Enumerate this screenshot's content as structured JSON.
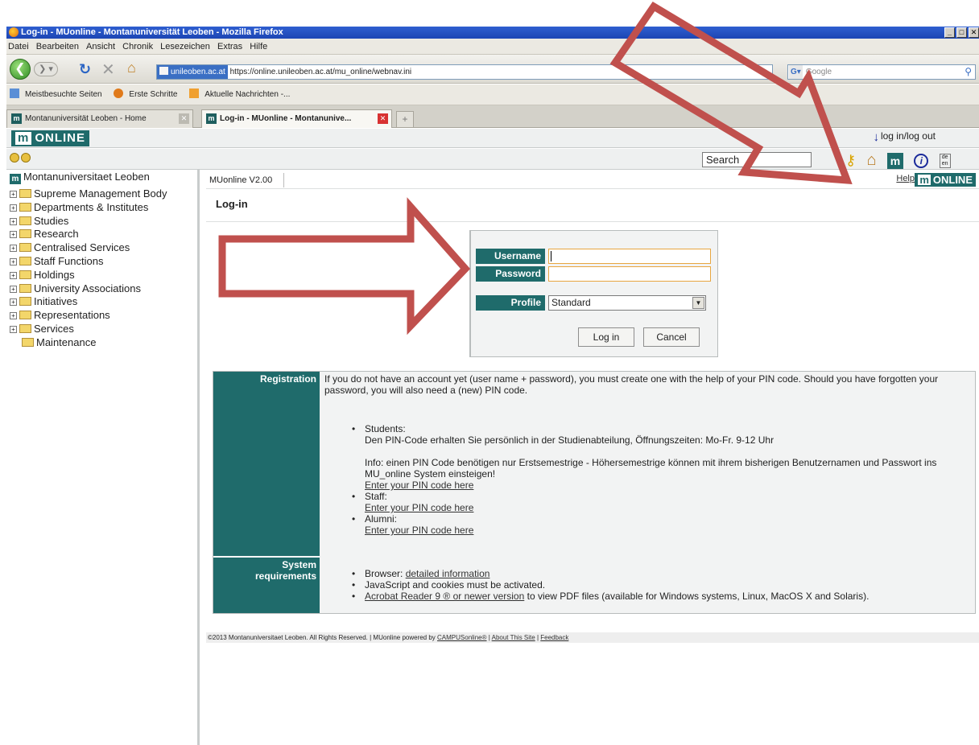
{
  "window": {
    "title": "Log-in - MUonline - Montanuniversität Leoben - Mozilla Firefox",
    "controls": "_ 8 x"
  },
  "menu": [
    "Datei",
    "Bearbeiten",
    "Ansicht",
    "Chronik",
    "Lesezeichen",
    "Extras",
    "Hilfe"
  ],
  "address": {
    "site_badge": "unileoben.ac.at",
    "url": "https://online.unileoben.ac.at/mu_online/webnav.ini",
    "search_placeholder": "Google"
  },
  "bookmarks": [
    "Meistbesuchte Seiten",
    "Erste Schritte",
    "Aktuelle Nachrichten -..."
  ],
  "tabs": [
    {
      "label": "Montanuniversität Leoben - Home",
      "active": false
    },
    {
      "label": "Log-in - MUonline - Montanunive...",
      "active": true
    }
  ],
  "app": {
    "logo_text": "ONLINE",
    "logo_mark": "m",
    "login_logout": "log in/log out",
    "search_value": "Search",
    "lang_toggle": "de en"
  },
  "tree": {
    "root": "Montanuniversitaet Leoben",
    "items": [
      {
        "label": "Supreme Management Body",
        "expandable": true
      },
      {
        "label": "Departments & Institutes",
        "expandable": true
      },
      {
        "label": "Studies",
        "expandable": true
      },
      {
        "label": "Research",
        "expandable": true
      },
      {
        "label": "Centralised Services",
        "expandable": true
      },
      {
        "label": "Staff Functions",
        "expandable": true
      },
      {
        "label": "Holdings",
        "expandable": true
      },
      {
        "label": "University Associations",
        "expandable": true
      },
      {
        "label": "Initiatives",
        "expandable": true
      },
      {
        "label": "Representations",
        "expandable": true
      },
      {
        "label": "Services",
        "expandable": true
      },
      {
        "label": "Maintenance",
        "expandable": false
      }
    ]
  },
  "content": {
    "version": "MUonline V2.00",
    "help": "Help",
    "version_logo": "ONLINE",
    "page_title": "Log-in"
  },
  "login": {
    "username_label": "Username",
    "username_value": "",
    "password_label": "Password",
    "password_value": "",
    "profile_label": "Profile",
    "profile_value": "Standard",
    "login_button": "Log in",
    "cancel_button": "Cancel"
  },
  "registration": {
    "label": "Registration",
    "intro": "If you do not have an account yet (user name + password), you must create one with the help of your PIN code. Should you have forgotten your password, you will also need a (new) PIN code.",
    "students_title": "Students:",
    "students_text": "Den PIN-Code erhalten Sie persönlich in der Studienabteilung, Öffnungszeiten: Mo-Fr. 9-12 Uhr",
    "students_info": "Info: einen PIN Code benötigen nur Erstsemestrige - Höhersemestrige können mit ihrem bisherigen Benutzernamen und Passwort ins MU_online System einsteigen!",
    "students_link": "Enter your PIN code here",
    "staff_title": "Staff:",
    "staff_link": "Enter your PIN code here",
    "alumni_title": "Alumni:",
    "alumni_link": "Enter your PIN code here"
  },
  "system": {
    "label_line1": "System",
    "label_line2": "requirements",
    "browser_prefix": "Browser: ",
    "browser_link": "detailed information",
    "js_text": "JavaScript and cookies must be activated.",
    "acrobat_link": "Acrobat Reader 9 ® or newer version",
    "acrobat_suffix": " to view PDF files (available for Windows systems, Linux, MacOS X and Solaris)."
  },
  "footer": {
    "text": "©2013 Montanuniversitaet Leoben. All Rights Reserved. | MUonline powered by ",
    "campus_link": "CAMPUSonline®",
    "sep1": " | ",
    "about_link": "About This Site",
    "sep2": " | ",
    "feedback_link": "Feedback"
  },
  "annotation_color": "#c0504d"
}
